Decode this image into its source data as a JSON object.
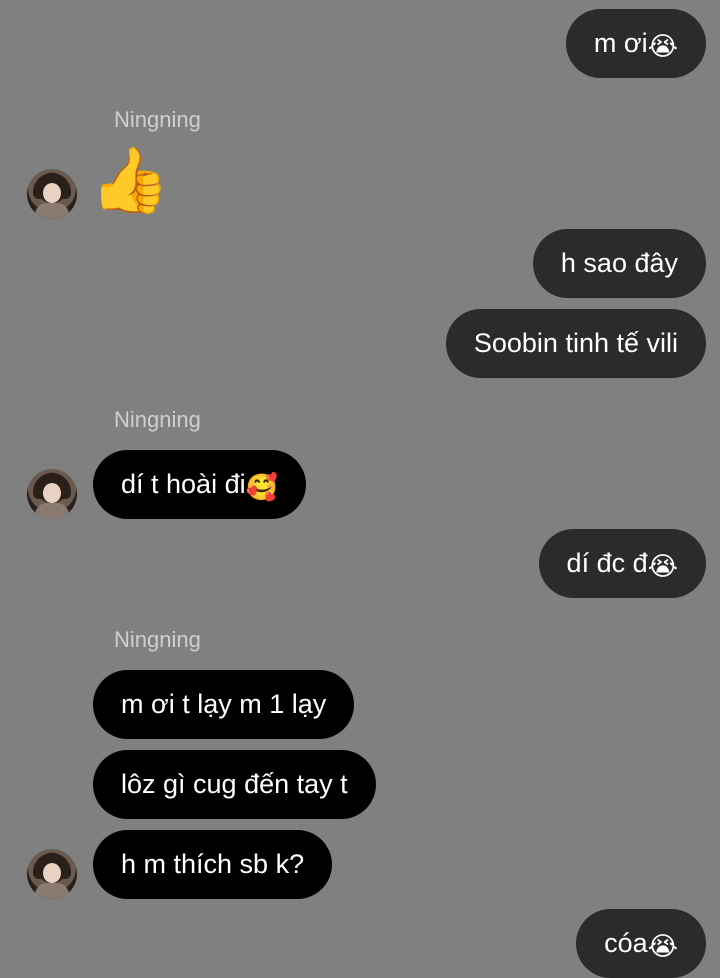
{
  "messages": [
    {
      "dir": "out",
      "text": "m ơi",
      "emoji": "😭"
    },
    {
      "dir": "sender",
      "text": "Ningning"
    },
    {
      "dir": "in-emoji",
      "emoji": "👍"
    },
    {
      "dir": "out",
      "text": "h sao đây"
    },
    {
      "dir": "out",
      "text": "Soobin tinh tế vili"
    },
    {
      "dir": "sender",
      "text": "Ningning"
    },
    {
      "dir": "in",
      "text": "dí t hoài đi",
      "emoji": "🥰"
    },
    {
      "dir": "out",
      "text": "dí đc đ",
      "emoji": "😭"
    },
    {
      "dir": "sender",
      "text": "Ningning"
    },
    {
      "dir": "in",
      "text": "m ơi t lạy m 1 lạy"
    },
    {
      "dir": "in",
      "text": "lôz gì cug đến tay t"
    },
    {
      "dir": "in",
      "text": "h m thích sb k?"
    },
    {
      "dir": "out",
      "text": "cóa",
      "emoji": "😭"
    }
  ],
  "colors": {
    "background": "#808080",
    "outgoing_bubble": "#2b2b2b",
    "incoming_bubble": "#000000",
    "text": "#ffffff",
    "sender_label": "#cfcfcf"
  }
}
